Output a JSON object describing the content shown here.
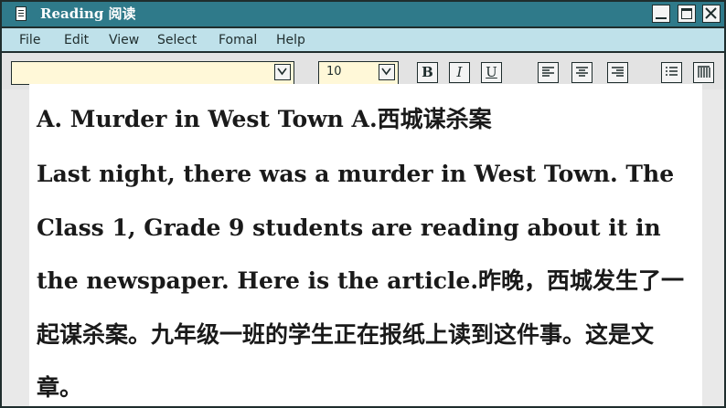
{
  "window": {
    "title": "Reading 阅读",
    "controls": [
      "minimize",
      "maximize",
      "close"
    ]
  },
  "menu": {
    "items": [
      "File",
      "Edit",
      "View",
      "Select",
      "Fomal",
      "Help"
    ]
  },
  "toolbar": {
    "font_family_value": "",
    "font_size_value": "10",
    "format_buttons": [
      "B",
      "I",
      "U"
    ],
    "align_buttons": [
      "align-left-icon",
      "align-center-icon",
      "align-right-icon"
    ],
    "other_buttons": [
      "list-icon",
      "columns-icon"
    ]
  },
  "document": {
    "heading": "A. Murder in West Town A.西城谋杀案",
    "body": "Last night, there was a murder in West Town. The Class 1, Grade 9 students are reading about it in the newspaper. Here is the article.昨晚，西城发生了一起谋杀案。九年级一班的学生正在报纸上读到这件事。这是文章。"
  },
  "colors": {
    "title_bar": "#2f7a8a",
    "menu_bar": "#bfe1ea",
    "input_bg": "#fff8d8",
    "outline": "#1f2d2d"
  }
}
